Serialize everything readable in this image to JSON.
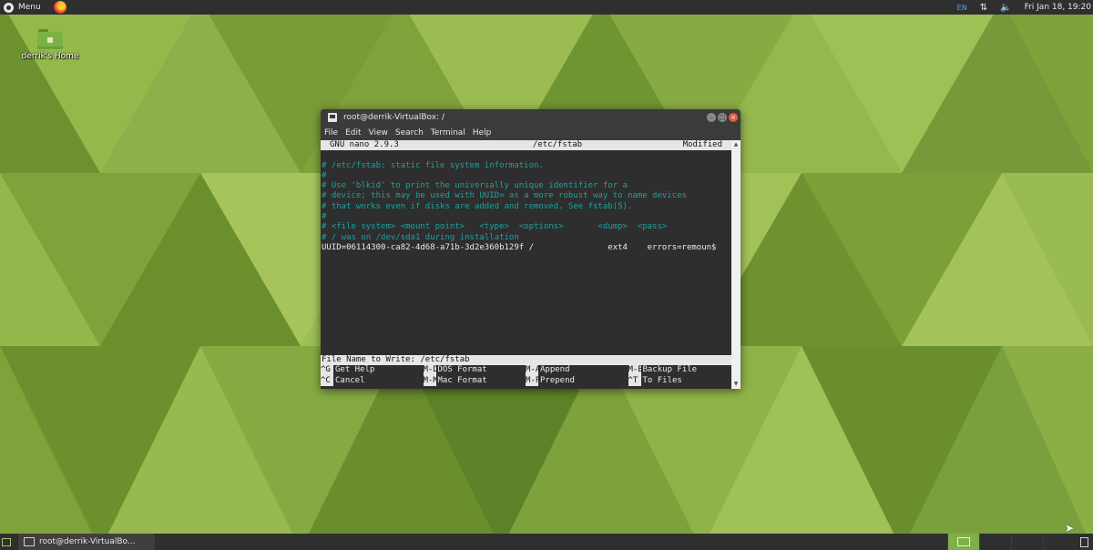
{
  "top_panel": {
    "menu_label": "Menu",
    "lang": "EN",
    "network_icon": "network-icon",
    "volume_icon": "volume-icon",
    "clock": "Fri Jan 18, 19:20"
  },
  "desktop": {
    "home_icon_label": "derrik's Home"
  },
  "window": {
    "title": "root@derrik-VirtualBox: /",
    "menu": [
      "File",
      "Edit",
      "View",
      "Search",
      "Terminal",
      "Help"
    ]
  },
  "nano": {
    "version": "GNU nano 2.9.3",
    "filename": "/etc/fstab",
    "status": "Modified",
    "lines": [
      {
        "text": "# /etc/fstab: static file system information.",
        "type": "comment"
      },
      {
        "text": "#",
        "type": "comment"
      },
      {
        "text": "# Use 'blkid' to print the universally unique identifier for a",
        "type": "comment"
      },
      {
        "text": "# device; this may be used with UUID= as a more robust way to name devices",
        "type": "comment"
      },
      {
        "text": "# that works even if disks are added and removed. See fstab(5).",
        "type": "comment"
      },
      {
        "text": "#",
        "type": "comment"
      },
      {
        "text": "# <file system> <mount point>   <type>  <options>       <dump>  <pass>",
        "type": "comment"
      },
      {
        "text": "# / was on /dev/sda1 during installation",
        "type": "comment"
      },
      {
        "text": "UUID=06114300-ca82-4d68-a71b-3d2e360b129f /               ext4    errors=remoun$",
        "type": "normal"
      }
    ],
    "prompt": "File Name to Write: /etc/fstab",
    "shortcuts_row1": [
      {
        "key": "^G",
        "desc": "Get Help"
      },
      {
        "key": "M-D",
        "desc": "DOS Format"
      },
      {
        "key": "M-A",
        "desc": "Append"
      },
      {
        "key": "M-B",
        "desc": "Backup File"
      }
    ],
    "shortcuts_row2": [
      {
        "key": "^C",
        "desc": "Cancel"
      },
      {
        "key": "M-M",
        "desc": "Mac Format"
      },
      {
        "key": "M-P",
        "desc": "Prepend"
      },
      {
        "key": "^T",
        "desc": "To Files"
      }
    ]
  },
  "bottom_panel": {
    "task_label": "root@derrik-VirtualBo..."
  },
  "colors": {
    "accent_green": "#7fae4a",
    "terminal_bg": "#2e2e2e",
    "comment_cyan": "#1aa3a3"
  }
}
